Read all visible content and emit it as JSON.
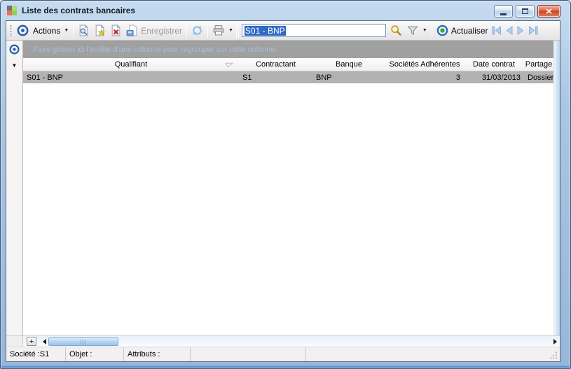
{
  "window": {
    "title": "Liste des contrats bancaires"
  },
  "toolbar": {
    "actions_label": "Actions",
    "save_label": "Enregistrer",
    "filter_value": "S01 - BNP",
    "refresh_label": "Actualiser"
  },
  "glyphs": {
    "dropdown": "▼",
    "plus": "+"
  },
  "grid": {
    "group_hint": "Faire glisser ici l'entête d'une colonne pour regrouper sur cette colonne.",
    "columns": [
      "Qualifiant",
      "Contractant",
      "Banque",
      "Sociétés Adhérentes",
      "Date contrat",
      "Partage"
    ],
    "rows": [
      {
        "qualifiant": "S01 - BNP",
        "contractant": "S1",
        "banque": "BNP",
        "societes_adherentes": "3",
        "date_contrat": "31/03/2013",
        "partage": "Dossier"
      }
    ]
  },
  "statusbar": {
    "societe": "Société :S1",
    "objet": "Objet :",
    "attributs": "Attributs :"
  },
  "colors": {
    "selection_blue": "#316ac5",
    "selected_row_gray": "#b2b2b2",
    "titlebar_blue": "#a9c6e3",
    "close_button_red": "#c83e23",
    "group_hint_text": "#a9bedb"
  }
}
